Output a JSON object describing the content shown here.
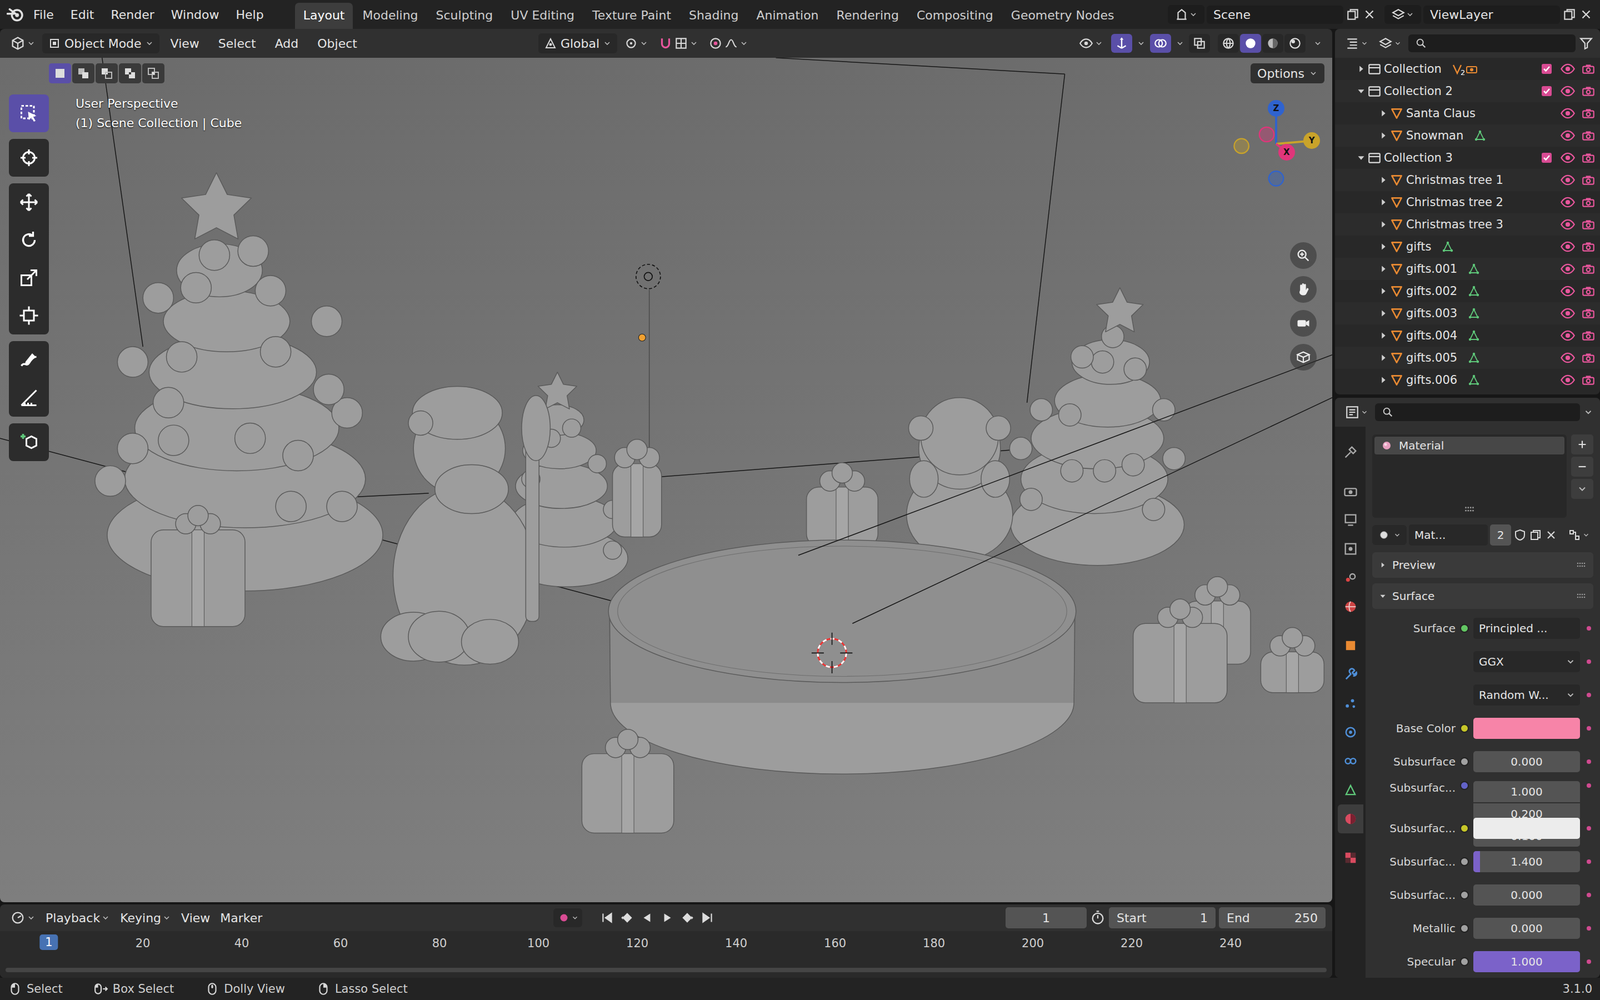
{
  "topbar": {
    "menus": [
      "File",
      "Edit",
      "Render",
      "Window",
      "Help"
    ],
    "workspaces": [
      {
        "label": "Layout",
        "selected": true
      },
      {
        "label": "Modeling",
        "selected": false
      },
      {
        "label": "Sculpting",
        "selected": false
      },
      {
        "label": "UV Editing",
        "selected": false
      },
      {
        "label": "Texture Paint",
        "selected": false
      },
      {
        "label": "Shading",
        "selected": false
      },
      {
        "label": "Animation",
        "selected": false
      },
      {
        "label": "Rendering",
        "selected": false
      },
      {
        "label": "Compositing",
        "selected": false
      },
      {
        "label": "Geometry Nodes",
        "selected": false
      }
    ],
    "scene": "Scene",
    "view_layer": "ViewLayer"
  },
  "viewport": {
    "mode": "Object Mode",
    "menus": [
      "View",
      "Select",
      "Add",
      "Object"
    ],
    "orientation": "Global",
    "options": "Options",
    "view_name": "User Perspective",
    "context": "(1) Scene Collection | Cube",
    "select_modes": [
      {
        "kind": "set",
        "selected": true
      },
      {
        "kind": "extend",
        "selected": false
      },
      {
        "kind": "subtract",
        "selected": false
      },
      {
        "kind": "difference",
        "selected": false
      },
      {
        "kind": "intersect",
        "selected": false
      }
    ],
    "tools": [
      {
        "kind": "select",
        "selected": true
      },
      {
        "kind": "cursor",
        "selected": false
      },
      {
        "kind": "move",
        "selected": false
      },
      {
        "kind": "rotate",
        "selected": false
      },
      {
        "kind": "scale",
        "selected": false
      },
      {
        "kind": "transform",
        "selected": false
      },
      {
        "kind": "annotate",
        "selected": false
      },
      {
        "kind": "measure",
        "selected": false
      },
      {
        "kind": "add_cube",
        "selected": false
      }
    ],
    "shading": [
      {
        "kind": "wireframe",
        "selected": false
      },
      {
        "kind": "solid",
        "selected": true
      },
      {
        "kind": "material",
        "selected": false
      },
      {
        "kind": "rendered",
        "selected": false
      }
    ],
    "gizmo": [
      {
        "axis": "Z",
        "color": "#2f63cf"
      },
      {
        "axis": "Y",
        "color": "#c9a32a"
      },
      {
        "axis": "X",
        "color": "#e0357a"
      }
    ]
  },
  "outliner": {
    "items": [
      {
        "label": "Collection",
        "kind": "collection",
        "expanded": false,
        "checked": true,
        "visible": true,
        "renderable": true,
        "badge": "2",
        "children": []
      },
      {
        "label": "Collection 2",
        "kind": "collection",
        "expanded": true,
        "checked": true,
        "visible": true,
        "renderable": true,
        "children": [
          {
            "label": "Santa Claus",
            "kind": "object",
            "expanded": false,
            "mesh_data": false,
            "visible": true,
            "renderable": true
          },
          {
            "label": "Snowman",
            "kind": "object",
            "expanded": false,
            "mesh_data": true,
            "visible": true,
            "renderable": true
          }
        ]
      },
      {
        "label": "Collection 3",
        "kind": "collection",
        "expanded": true,
        "checked": true,
        "visible": true,
        "renderable": true,
        "children": [
          {
            "label": "Christmas tree 1",
            "kind": "object",
            "expanded": false,
            "mesh_data": false,
            "visible": true,
            "renderable": true
          },
          {
            "label": "Christmas tree 2",
            "kind": "object",
            "expanded": false,
            "mesh_data": false,
            "visible": true,
            "renderable": true
          },
          {
            "label": "Christmas tree 3",
            "kind": "object",
            "expanded": false,
            "mesh_data": false,
            "visible": true,
            "renderable": true
          },
          {
            "label": "gifts",
            "kind": "object",
            "expanded": false,
            "mesh_data": true,
            "visible": true,
            "renderable": true
          },
          {
            "label": "gifts.001",
            "kind": "object",
            "expanded": false,
            "mesh_data": true,
            "visible": true,
            "renderable": true
          },
          {
            "label": "gifts.002",
            "kind": "object",
            "expanded": false,
            "mesh_data": true,
            "visible": true,
            "renderable": true
          },
          {
            "label": "gifts.003",
            "kind": "object",
            "expanded": false,
            "mesh_data": true,
            "visible": true,
            "renderable": true
          },
          {
            "label": "gifts.004",
            "kind": "object",
            "expanded": false,
            "mesh_data": true,
            "visible": true,
            "renderable": true
          },
          {
            "label": "gifts.005",
            "kind": "object",
            "expanded": false,
            "mesh_data": true,
            "visible": true,
            "renderable": true
          },
          {
            "label": "gifts.006",
            "kind": "object",
            "expanded": false,
            "mesh_data": true,
            "visible": true,
            "renderable": true
          }
        ]
      }
    ]
  },
  "properties": {
    "tabs": [
      {
        "kind": "tool",
        "selected": false
      },
      {
        "kind": "render",
        "selected": false
      },
      {
        "kind": "output",
        "selected": false
      },
      {
        "kind": "view_layer",
        "selected": false
      },
      {
        "kind": "scene",
        "selected": false
      },
      {
        "kind": "world",
        "selected": false
      },
      {
        "kind": "object",
        "selected": false
      },
      {
        "kind": "modifier",
        "selected": false
      },
      {
        "kind": "particles",
        "selected": false
      },
      {
        "kind": "physics",
        "selected": false
      },
      {
        "kind": "constraints",
        "selected": false
      },
      {
        "kind": "data",
        "selected": false
      },
      {
        "kind": "material",
        "selected": true
      },
      {
        "kind": "texture",
        "selected": false
      }
    ],
    "slots": [
      {
        "label": "Material",
        "selected": true
      }
    ],
    "material_name": "Mat...",
    "users": "2",
    "panels": [
      {
        "label": "Preview",
        "expanded": false
      },
      {
        "label": "Surface",
        "expanded": true
      }
    ],
    "rows": [
      {
        "label": "Surface",
        "kind": "node",
        "value": "Principled ...",
        "dot": "#63c763"
      },
      {
        "label": "",
        "kind": "dropdown",
        "value": "GGX"
      },
      {
        "label": "",
        "kind": "dropdown",
        "value": "Random W..."
      },
      {
        "label": "Base Color",
        "kind": "color",
        "color": "#f784a8",
        "dot": "#c7c729"
      },
      {
        "label": "Subsurface",
        "kind": "slider",
        "value": "0.000",
        "level": 0,
        "dot": "#a1a1a1"
      },
      {
        "label": "Subsurfac...",
        "kind": "vector",
        "values": [
          "1.000",
          "0.200",
          "0.100"
        ],
        "dot": "#6363c7"
      },
      {
        "label": "Subsurfac...",
        "kind": "color",
        "color": "#ececec",
        "dot": "#c7c729"
      },
      {
        "label": "Subsurfac...",
        "kind": "slider",
        "value": "1.400",
        "level": 0.06,
        "dot": "#a1a1a1"
      },
      {
        "label": "Subsurfac...",
        "kind": "slider",
        "value": "0.000",
        "level": 0,
        "dot": "#a1a1a1"
      },
      {
        "label": "Metallic",
        "kind": "slider",
        "value": "0.000",
        "level": 0,
        "dot": "#a1a1a1"
      },
      {
        "label": "Specular",
        "kind": "slider",
        "value": "1.000",
        "level": 1,
        "dot": "#a1a1a1"
      }
    ]
  },
  "timeline": {
    "menus": [
      "Playback",
      "Keying",
      "View",
      "Marker"
    ],
    "frame": "1",
    "start_label": "Start",
    "start": "1",
    "end_label": "End",
    "end": "250",
    "playhead": "1",
    "ruler": [
      "20",
      "40",
      "60",
      "80",
      "100",
      "120",
      "140",
      "160",
      "180",
      "200",
      "220",
      "240"
    ]
  },
  "status_bar": {
    "hints": [
      {
        "label": "Select",
        "kind": "lmb"
      },
      {
        "label": "Box Select",
        "kind": "drag"
      },
      {
        "label": "Dolly View",
        "kind": "mmb"
      },
      {
        "label": "Lasso Select",
        "kind": "rmb"
      }
    ],
    "version": "3.1.0"
  }
}
